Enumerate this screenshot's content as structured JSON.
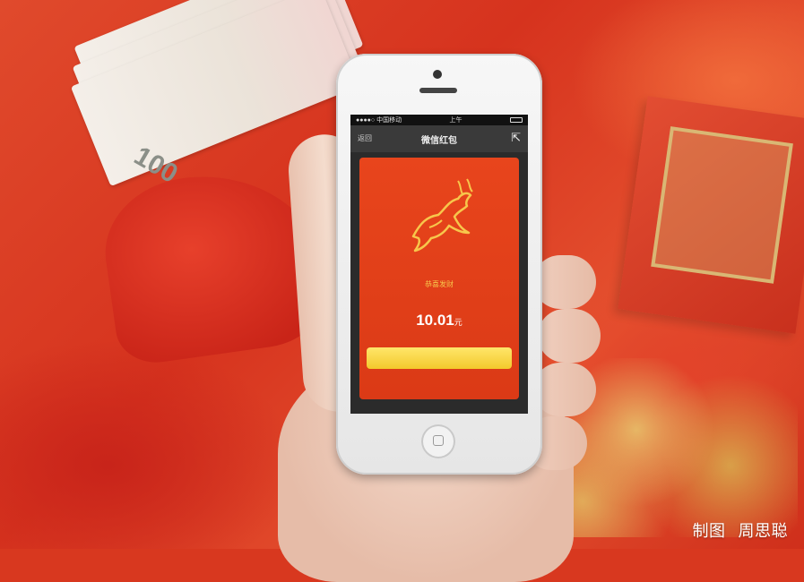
{
  "phone": {
    "status": {
      "carrier": "●●●●○ 中国移动",
      "time": "上午",
      "battery_icon": "battery-icon"
    },
    "nav": {
      "back": "返回",
      "title": "微信红包",
      "subtitle": "",
      "share_icon": "share-icon"
    },
    "packet": {
      "greeting": "恭喜发财",
      "line": "",
      "amount": "10.01",
      "amount_unit": "元",
      "cta": ""
    },
    "footer": ""
  },
  "scene": {
    "bill_number": "100"
  },
  "credit": {
    "label": "制图",
    "name": "周思聪"
  },
  "colors": {
    "packet_red": "#e8451c",
    "gold_text": "#f7c64b",
    "cta_yellow": "#f3c92c"
  }
}
